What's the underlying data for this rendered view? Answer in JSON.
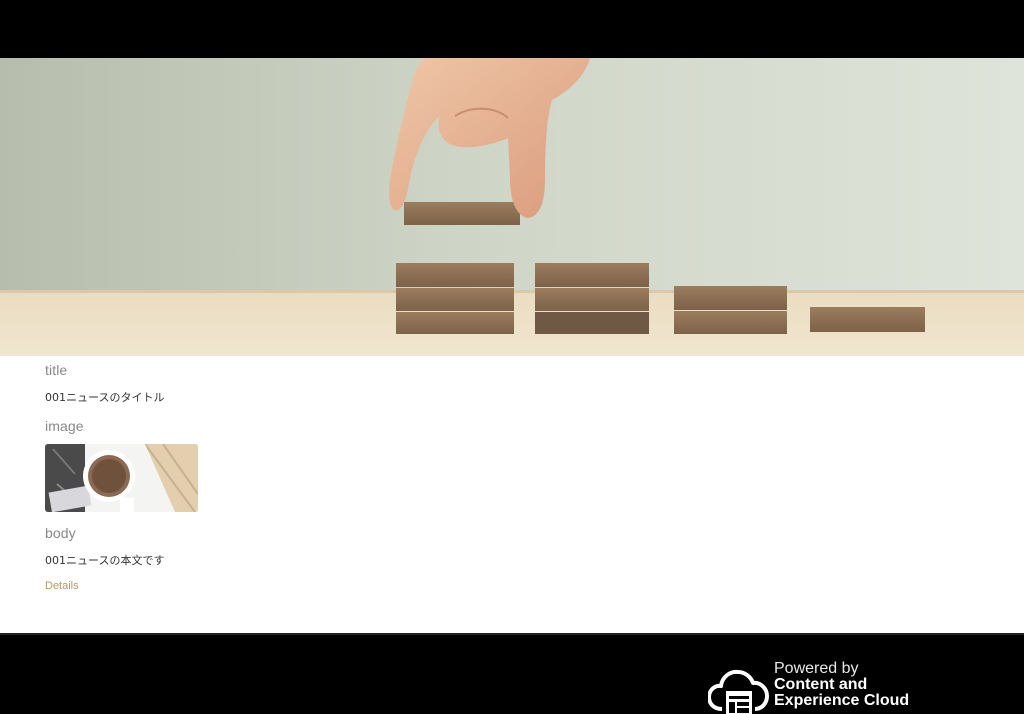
{
  "fields": {
    "title_label": "title",
    "title_value": "001ニュースのタイトル",
    "image_label": "image",
    "body_label": "body",
    "body_value": "001ニュースの本文です"
  },
  "links": {
    "details_label": "Details"
  },
  "footer": {
    "powered_by": "Powered by",
    "brand_line1": "Content and",
    "brand_line2": "Experience Cloud"
  },
  "colors": {
    "link": "#b59a5c",
    "header_bg": "#000000",
    "footer_bg": "#000000"
  },
  "icons": {
    "footer_logo": "cloud-content-icon"
  }
}
